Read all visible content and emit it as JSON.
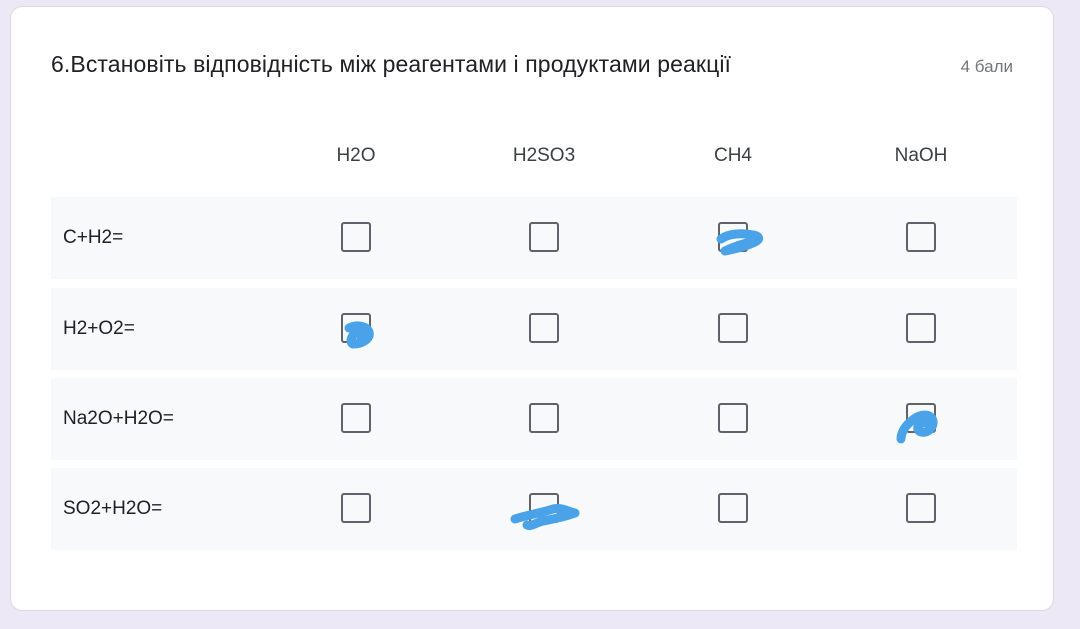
{
  "question": {
    "title": "6.Встановіть відповідність між реагентами і продуктами реакції",
    "points": "4 бали"
  },
  "columns": [
    "H2O",
    "H2SO3",
    "CH4",
    "NaOH"
  ],
  "rows": [
    {
      "label": "C+H2=",
      "marked": [
        false,
        false,
        true,
        false
      ]
    },
    {
      "label": "H2+O2=",
      "marked": [
        true,
        false,
        false,
        false
      ]
    },
    {
      "label": "Na2O+H2O=",
      "marked": [
        false,
        false,
        false,
        true
      ]
    },
    {
      "label": "SO2+H2O=",
      "marked": [
        false,
        true,
        false,
        false
      ]
    }
  ],
  "colors": {
    "background": "#ede8f6",
    "card": "#ffffff",
    "row_fill": "#f8f9fa",
    "checkbox_border": "#5f6368",
    "scribble": "#4aa3e8"
  },
  "icons": {
    "checkbox": "checkbox-icon",
    "scribble": "blue-pen-scribble"
  }
}
